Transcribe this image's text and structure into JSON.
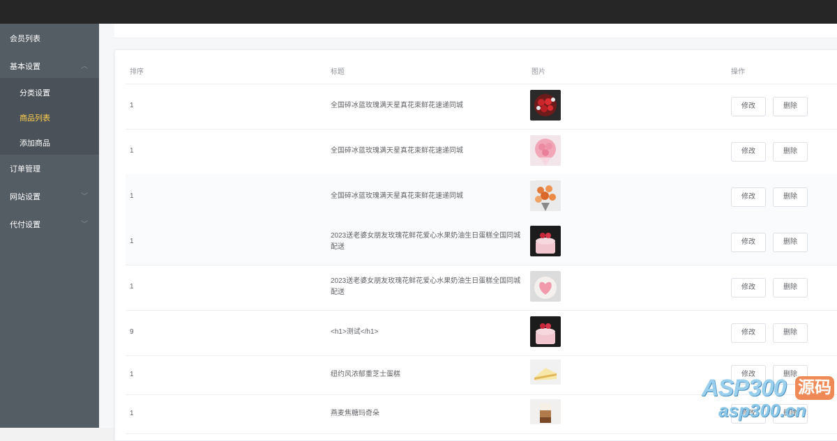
{
  "sidebar": {
    "items": [
      {
        "label": "会员列表"
      },
      {
        "label": "基本设置"
      },
      {
        "label": "订单管理"
      },
      {
        "label": "网站设置"
      },
      {
        "label": "代付设置"
      }
    ],
    "subitems": [
      {
        "label": "分类设置"
      },
      {
        "label": "商品列表"
      },
      {
        "label": "添加商品"
      }
    ],
    "active_color": "#ffd04b",
    "background": "#545c64"
  },
  "table": {
    "headers": {
      "sort": "排序",
      "title": "标题",
      "image": "图片",
      "action": "操作"
    },
    "edit_label": "修改",
    "delete_label": "删除",
    "rows": [
      {
        "sort": "1",
        "title": "全国碎冰蓝玫瑰满天星真花束鲜花速递同城",
        "image": "red-rose-bouquet-thumbnail"
      },
      {
        "sort": "1",
        "title": "全国碎冰蓝玫瑰满天星真花束鲜花速递同城",
        "image": "pink-rose-bouquet-thumbnail"
      },
      {
        "sort": "1",
        "title": "全国碎冰蓝玫瑰满天星真花束鲜花速递同城",
        "image": "orange-flower-bouquet-thumbnail"
      },
      {
        "sort": "1",
        "title": "2023送老婆女朋友玫瑰花鲜花爱心水果奶油生日蛋糕全国同城配送",
        "image": "pink-cake-thumbnail"
      },
      {
        "sort": "1",
        "title": "2023送老婆女朋友玫瑰花鲜花爱心水果奶油生日蛋糕全国同城配送",
        "image": "heart-cake-thumbnail"
      },
      {
        "sort": "9",
        "title": "<h1>测试</h1>",
        "image": "pink-cake-thumbnail"
      },
      {
        "sort": "1",
        "title": "纽约风浓郁重芝士蛋糕",
        "image": "cheesecake-thumbnail"
      },
      {
        "sort": "1",
        "title": "燕麦焦糖玛奇朵",
        "image": "macchiato-thumbnail"
      }
    ]
  },
  "watermark": {
    "brand": "ASP300",
    "badge": "源码",
    "url": "asp300.cn"
  }
}
